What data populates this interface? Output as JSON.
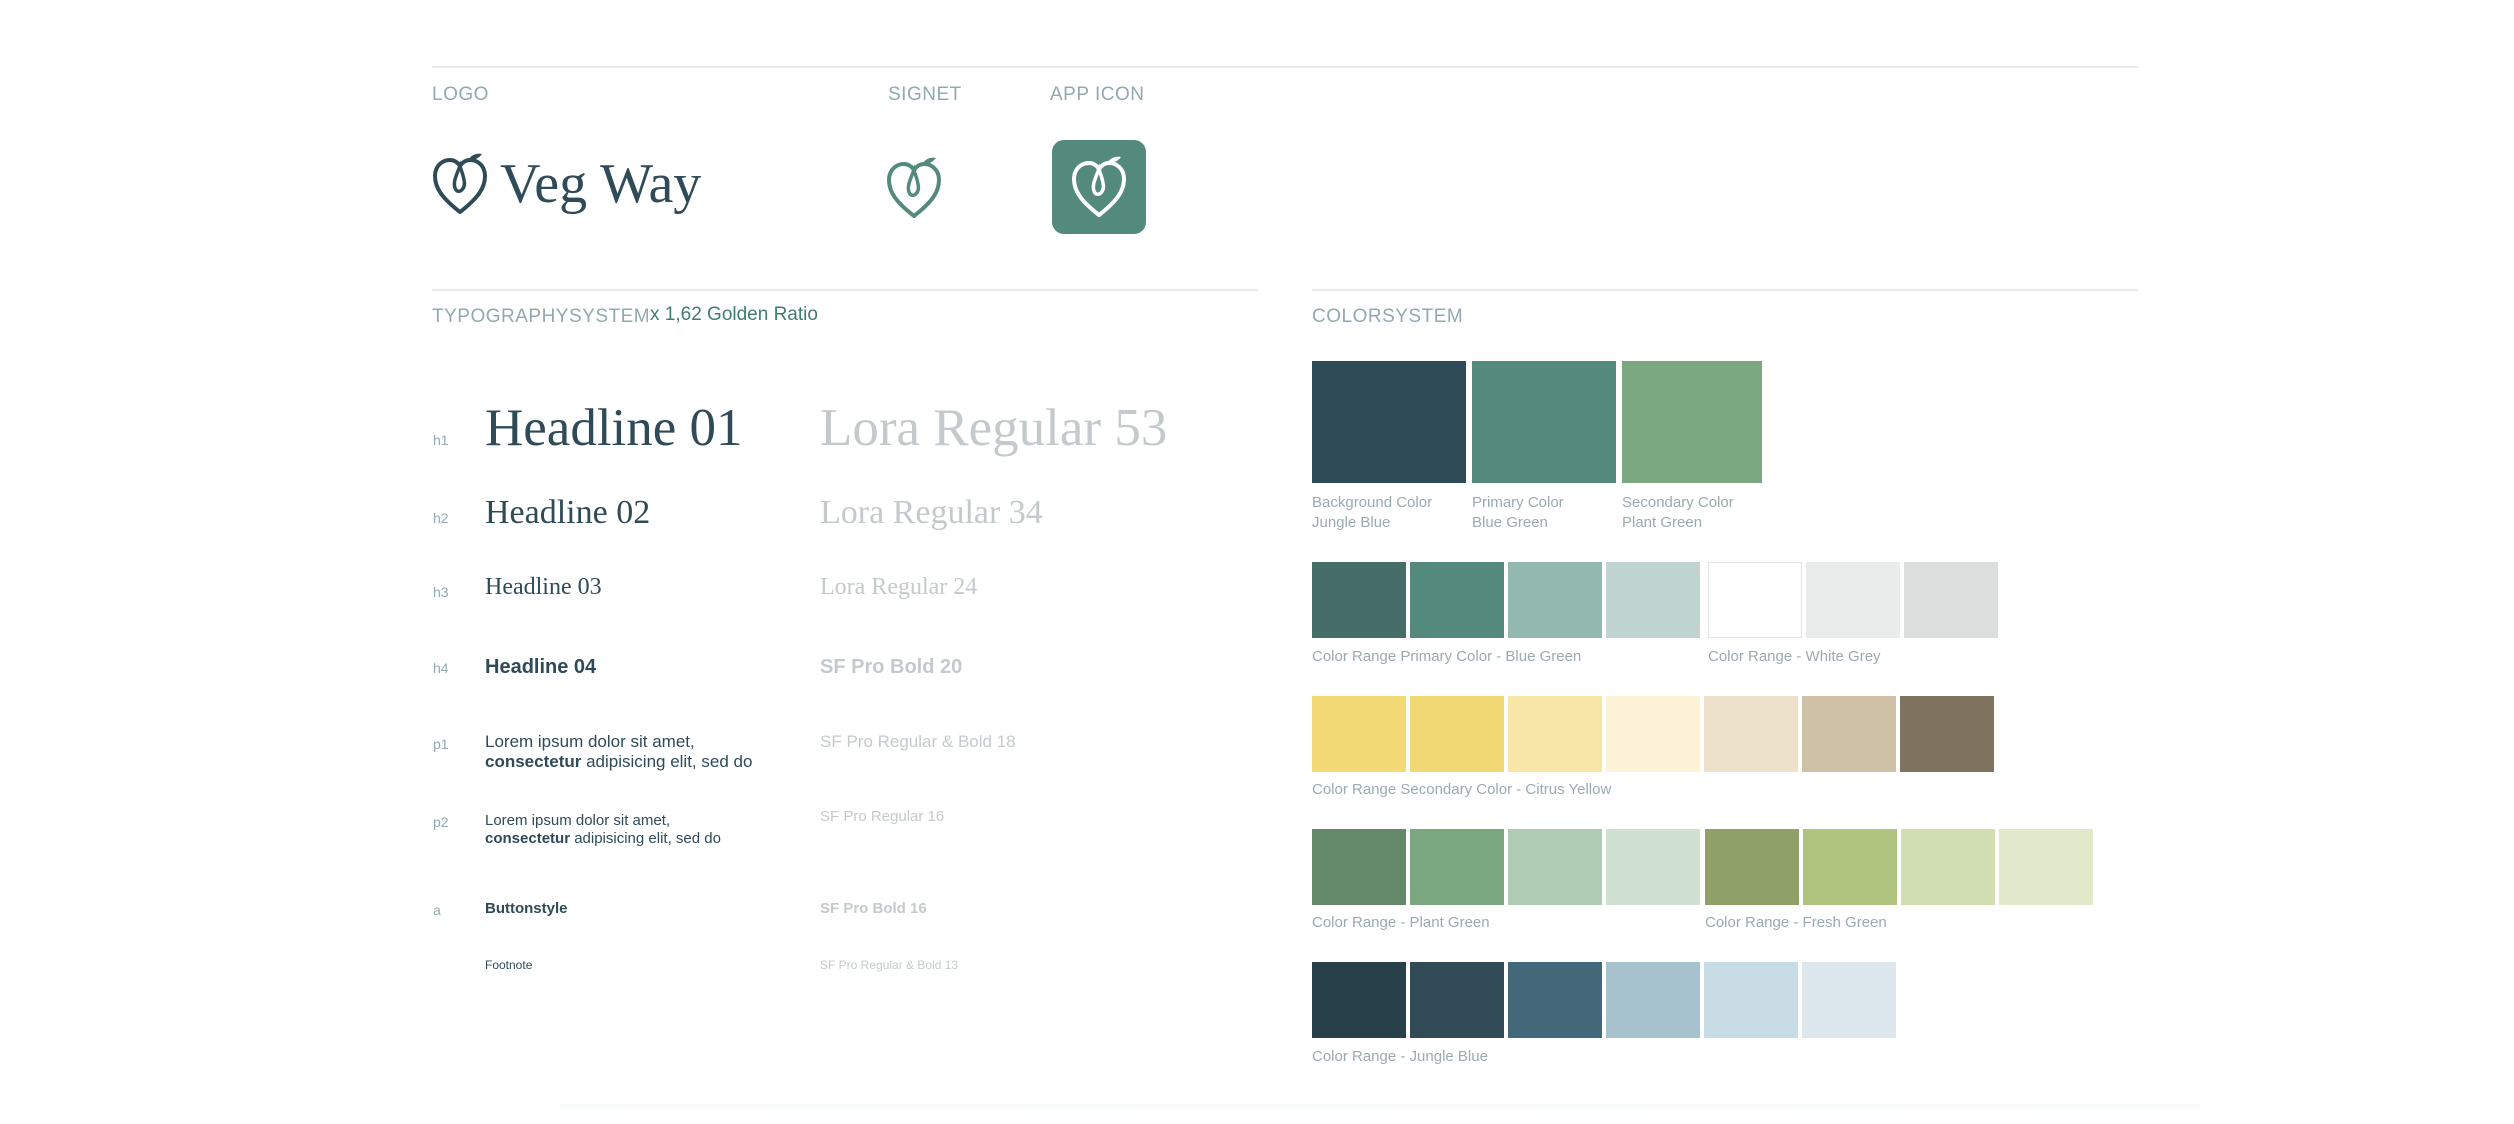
{
  "header": {
    "logo_label": "LOGO",
    "signet_label": "SIGNET",
    "app_icon_label": "APP ICON",
    "brand_name": "Veg Way"
  },
  "typography": {
    "section_label": "TYPOGRAPHYSYSTEM",
    "ratio_label": "x 1,62 Golden Ratio",
    "rows": [
      {
        "tag": "h1",
        "sample": "Headline 01",
        "spec": "Lora Regular 53"
      },
      {
        "tag": "h2",
        "sample": "Headline 02",
        "spec": "Lora Regular 34"
      },
      {
        "tag": "h3",
        "sample": "Headline 03",
        "spec": "Lora Regular 24"
      },
      {
        "tag": "h4",
        "sample": "Headline 04",
        "spec": "SF Pro Bold 20"
      },
      {
        "tag": "p1",
        "line1": "Lorem ipsum dolor sit amet,",
        "bold": "consectetur",
        "rest": " adipisicing elit, sed do",
        "spec": "SF Pro Regular & Bold 18"
      },
      {
        "tag": "p2",
        "line1": "Lorem ipsum dolor sit amet,",
        "bold": "consectetur",
        "rest": " adipisicing elit, sed do",
        "spec": "SF Pro Regular 16"
      },
      {
        "tag": "a",
        "sample": "Buttonstyle",
        "spec": "SF Pro Bold 16"
      },
      {
        "tag": "",
        "sample": "Footnote",
        "spec": "SF Pro Regular & Bold 13"
      }
    ]
  },
  "colors": {
    "section_label": "COLORSYSTEM",
    "main": [
      {
        "hex": "#2f4b57",
        "line1": "Background Color",
        "line2": "Jungle Blue"
      },
      {
        "hex": "#548a7e",
        "line1": "Primary Color",
        "line2": "Blue Green"
      },
      {
        "hex": "#7ca881",
        "line1": "Secondary Color",
        "line2": "Plant Green"
      }
    ],
    "ranges": {
      "primary_label": "Color Range Primary Color - Blue Green",
      "primary": [
        "#456e68",
        "#548a7e",
        "#93b8b0",
        "#bfd4cf"
      ],
      "white_label": "Color Range - White Grey",
      "white": [
        "#ffffff",
        "#eaecec",
        "#dcdedd"
      ],
      "yellow_label": "Color Range Secondary Color - Citrus Yellow",
      "yellow": [
        "#f3da76",
        "#f2d874",
        "#f8e6a6",
        "#fcf2d7",
        "#ede1cb",
        "#cfc0a8",
        "#7d735f"
      ],
      "plant_label": "Color Range - Plant Green",
      "plant": [
        "#64886a",
        "#7ca881",
        "#b0cbb3",
        "#d0e1d2"
      ],
      "fresh_label": "Color Range - Fresh Green",
      "fresh": [
        "#8fa068",
        "#afc57f",
        "#d0deb1",
        "#e0e9c9"
      ],
      "jungle_label": "Color Range - Jungle Blue",
      "jungle": [
        "#27404a",
        "#314c57",
        "#426879",
        "#a5c2cd",
        "#c7dce4",
        "#dce8ed"
      ]
    }
  }
}
